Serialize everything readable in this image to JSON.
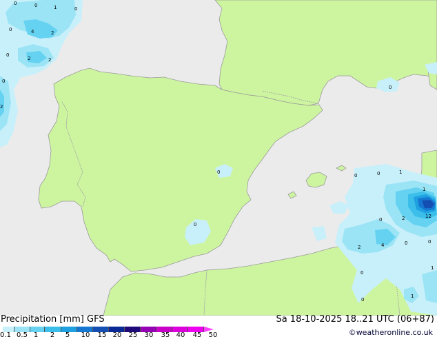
{
  "legend": {
    "title": "Precipitation [mm]",
    "model": "GFS",
    "ticks": [
      "0.1",
      "0.5",
      "1",
      "2",
      "5",
      "10",
      "15",
      "20",
      "25",
      "30",
      "35",
      "40",
      "45",
      "50"
    ],
    "colors": [
      "#c8f0fa",
      "#9be4f5",
      "#64d2f0",
      "#3cbeeb",
      "#1ea0e1",
      "#1478d2",
      "#1450b4",
      "#0a2896",
      "#1e0a78",
      "#9600b4",
      "#c800c8",
      "#dc00dc",
      "#f000f0",
      "#ff40ff"
    ]
  },
  "valid_time": "Sa 18-10-2025 18..21 UTC (06+87)",
  "credit": "©weatheronline.co.uk",
  "map": {
    "colors": {
      "sea": "#ebebeb",
      "land": "#cdf5a0",
      "border": "#a0a0a0",
      "coast": "#9a9a9a"
    },
    "values": [
      "0",
      "0",
      "1",
      "0",
      "0",
      "4",
      "2",
      "0",
      "2",
      "2",
      "0",
      "2",
      "0",
      "0",
      "0",
      "0",
      "1",
      "1",
      "12",
      "0",
      "2",
      "2",
      "4",
      "0",
      "0",
      "0",
      "0",
      "1",
      "0",
      "1"
    ]
  }
}
